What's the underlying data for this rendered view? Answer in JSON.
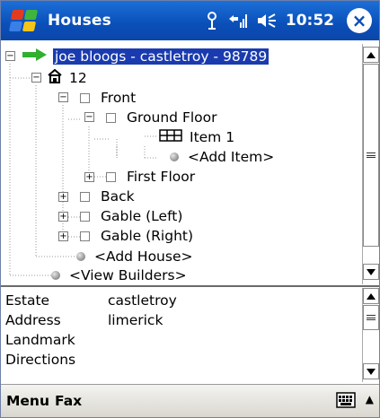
{
  "titlebar": {
    "app_title": "Houses",
    "time": "10:52",
    "icons": [
      "windows-start-icon",
      "antenna-icon",
      "connectivity-icon",
      "speaker-icon",
      "close-icon"
    ],
    "close_label": "×",
    "color": "#0a4fb8"
  },
  "tree": {
    "root": "joe bloogs - castletroy - 98789",
    "house": "12",
    "nodes": {
      "front": "Front",
      "ground_floor": "Ground Floor",
      "item1": "Item 1",
      "add_item": "<Add Item>",
      "first_floor": "First Floor",
      "back": "Back",
      "gable_left": "Gable (Left)",
      "gable_right": "Gable (Right)",
      "add_house": "<Add House>",
      "view_builders": "<View Builders>"
    },
    "selection_color": "#1a3bb0"
  },
  "details": {
    "rows": [
      {
        "key": "Estate",
        "value": "castletroy"
      },
      {
        "key": "Address",
        "value": "limerick"
      },
      {
        "key": "Landmark",
        "value": ""
      },
      {
        "key": "Directions",
        "value": ""
      }
    ]
  },
  "menubar": {
    "menu": "Menu",
    "fax": "Fax",
    "sip_arrow": "▲"
  }
}
